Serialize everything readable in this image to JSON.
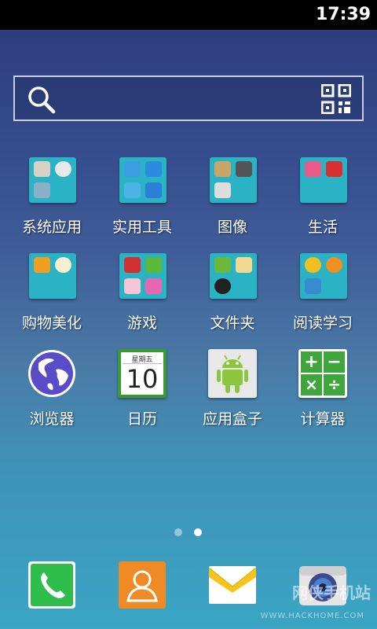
{
  "status_bar": {
    "time": "17:39"
  },
  "search": {
    "search_icon": "search-icon",
    "qr_icon": "qr-code-icon"
  },
  "apps_row1": [
    {
      "label": "系统应用",
      "icon": "folder-icon"
    },
    {
      "label": "实用工具",
      "icon": "folder-icon"
    },
    {
      "label": "图像",
      "icon": "folder-icon"
    },
    {
      "label": "生活",
      "icon": "folder-icon"
    }
  ],
  "apps_row2": [
    {
      "label": "购物美化",
      "icon": "folder-icon"
    },
    {
      "label": "游戏",
      "icon": "folder-icon"
    },
    {
      "label": "文件夹",
      "icon": "folder-icon"
    },
    {
      "label": "阅读学习",
      "icon": "folder-icon"
    }
  ],
  "apps_row3": [
    {
      "label": "浏览器",
      "icon": "globe-icon"
    },
    {
      "label": "日历",
      "icon": "calendar-icon",
      "weekday": "星期五",
      "day": "10"
    },
    {
      "label": "应用盒子",
      "icon": "android-icon"
    },
    {
      "label": "计算器",
      "icon": "calculator-icon"
    }
  ],
  "page_indicator": {
    "pages": 2,
    "current": 2
  },
  "dock": [
    {
      "name": "phone",
      "icon": "phone-icon"
    },
    {
      "name": "contacts",
      "icon": "contacts-icon"
    },
    {
      "name": "messages",
      "icon": "message-icon"
    },
    {
      "name": "camera",
      "icon": "camera-icon"
    }
  ],
  "watermark": {
    "text": "网侠手机站",
    "url": "WWW.HACKHOME.COM"
  },
  "colors": {
    "folder": "#29b3c4",
    "phone": "#2ebd4a",
    "contacts": "#f08a24",
    "calculator": "#3fa63c"
  }
}
